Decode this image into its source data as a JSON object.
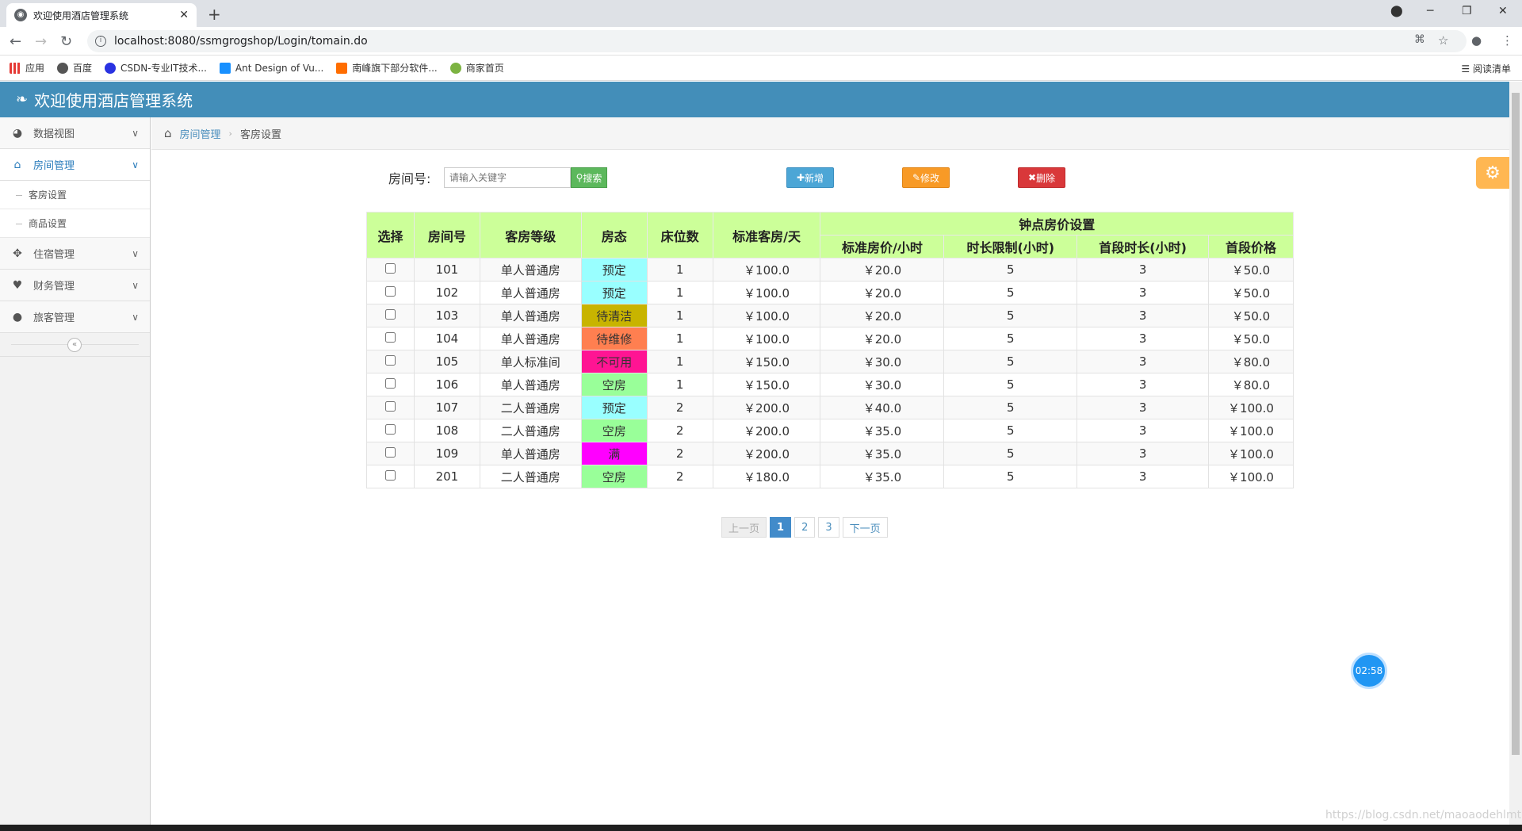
{
  "browser": {
    "tab_title": "欢迎使用酒店管理系统",
    "url": "localhost:8080/ssmgrogshop/Login/tomain.do",
    "bookmarks": [
      "应用",
      "百度",
      "CSDN-专业IT技术...",
      "Ant Design of Vu...",
      "南峰旗下部分软件...",
      "商家首页"
    ],
    "reading_list": "阅读清单"
  },
  "header": {
    "title": "欢迎使用酒店管理系统"
  },
  "sidebar": {
    "items": [
      {
        "label": "数据视图"
      },
      {
        "label": "房间管理",
        "active": true,
        "children": [
          "客房设置",
          "商品设置"
        ]
      },
      {
        "label": "住宿管理"
      },
      {
        "label": "财务管理"
      },
      {
        "label": "旅客管理"
      }
    ]
  },
  "breadcrumb": {
    "parent": "房间管理",
    "current": "客房设置"
  },
  "toolbar": {
    "search_label": "房间号:",
    "search_placeholder": "请输入关键字",
    "search_btn": "搜索",
    "add_btn": "新增",
    "edit_btn": "修改",
    "delete_btn": "删除"
  },
  "table": {
    "group_header": "钟点房价设置",
    "headers": [
      "选择",
      "房间号",
      "客房等级",
      "房态",
      "床位数",
      "标准客房/天",
      "标准房价/小时",
      "时长限制(小时)",
      "首段时长(小时)",
      "首段价格"
    ],
    "rows": [
      {
        "room": "101",
        "grade": "单人普通房",
        "status": "预定",
        "status_color": "#99ffff",
        "beds": "1",
        "day_price": "￥100.0",
        "hour_price": "￥20.0",
        "limit": "5",
        "first": "3",
        "first_price": "￥50.0"
      },
      {
        "room": "102",
        "grade": "单人普通房",
        "status": "预定",
        "status_color": "#99ffff",
        "beds": "1",
        "day_price": "￥100.0",
        "hour_price": "￥20.0",
        "limit": "5",
        "first": "3",
        "first_price": "￥50.0"
      },
      {
        "room": "103",
        "grade": "单人普通房",
        "status": "待清洁",
        "status_color": "#c8b400",
        "beds": "1",
        "day_price": "￥100.0",
        "hour_price": "￥20.0",
        "limit": "5",
        "first": "3",
        "first_price": "￥50.0"
      },
      {
        "room": "104",
        "grade": "单人普通房",
        "status": "待维修",
        "status_color": "#ff7f50",
        "beds": "1",
        "day_price": "￥100.0",
        "hour_price": "￥20.0",
        "limit": "5",
        "first": "3",
        "first_price": "￥50.0"
      },
      {
        "room": "105",
        "grade": "单人标准间",
        "status": "不可用",
        "status_color": "#ff1493",
        "beds": "1",
        "day_price": "￥150.0",
        "hour_price": "￥30.0",
        "limit": "5",
        "first": "3",
        "first_price": "￥80.0"
      },
      {
        "room": "106",
        "grade": "单人普通房",
        "status": "空房",
        "status_color": "#99ff99",
        "beds": "1",
        "day_price": "￥150.0",
        "hour_price": "￥30.0",
        "limit": "5",
        "first": "3",
        "first_price": "￥80.0"
      },
      {
        "room": "107",
        "grade": "二人普通房",
        "status": "预定",
        "status_color": "#99ffff",
        "beds": "2",
        "day_price": "￥200.0",
        "hour_price": "￥40.0",
        "limit": "5",
        "first": "3",
        "first_price": "￥100.0"
      },
      {
        "room": "108",
        "grade": "二人普通房",
        "status": "空房",
        "status_color": "#99ff99",
        "beds": "2",
        "day_price": "￥200.0",
        "hour_price": "￥35.0",
        "limit": "5",
        "first": "3",
        "first_price": "￥100.0"
      },
      {
        "room": "109",
        "grade": "单人普通房",
        "status": "满",
        "status_color": "#ff00ff",
        "beds": "2",
        "day_price": "￥200.0",
        "hour_price": "￥35.0",
        "limit": "5",
        "first": "3",
        "first_price": "￥100.0"
      },
      {
        "room": "201",
        "grade": "二人普通房",
        "status": "空房",
        "status_color": "#99ff99",
        "beds": "2",
        "day_price": "￥180.0",
        "hour_price": "￥35.0",
        "limit": "5",
        "first": "3",
        "first_price": "￥100.0"
      }
    ]
  },
  "pagination": {
    "prev": "上一页",
    "pages": [
      "1",
      "2",
      "3"
    ],
    "current": "1",
    "next": "下一页"
  },
  "timer": "02:58",
  "watermark": "https://blog.csdn.net/maoaodehlmt",
  "colors": {
    "header_bg": "#438eb9",
    "table_header_bg": "#ccff99",
    "link": "#4c8fbd"
  }
}
